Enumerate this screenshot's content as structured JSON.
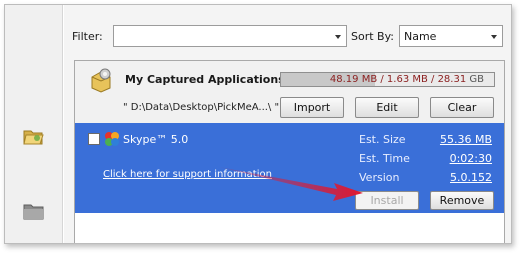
{
  "filter": {
    "label": "Filter:",
    "value": ""
  },
  "sort": {
    "label": "Sort By:",
    "value": "Name"
  },
  "captured": {
    "title": "My Captured Applications",
    "size_text_main": "48.19 MB / 1.63 MB / 28.31",
    "size_text_unit": " GB",
    "usage_fraction": 0.44,
    "path": "\" D:\\Data\\Desktop\\PickMeA...\\ \"",
    "import_label": "Import",
    "edit_label": "Edit",
    "clear_label": "Clear"
  },
  "app": {
    "name": "Skype™ 5.0",
    "support_link": "Click here for support information",
    "est_size_label": "Est. Size",
    "est_size_value": "55.36 MB",
    "est_time_label": "Est. Time",
    "est_time_value": "0:02:30",
    "version_label": "Version",
    "version_value": "5.0.152",
    "install_label": "Install",
    "remove_label": "Remove"
  },
  "icons": {
    "rail_active": "open-folder-icon",
    "rail_inactive": "folder-icon",
    "captured": "package-icon",
    "app": "skype-icon"
  },
  "colors": {
    "selection": "#3a6fd8",
    "size_text": "#8b1e1e",
    "annotation_arrow": "#e0182e"
  }
}
